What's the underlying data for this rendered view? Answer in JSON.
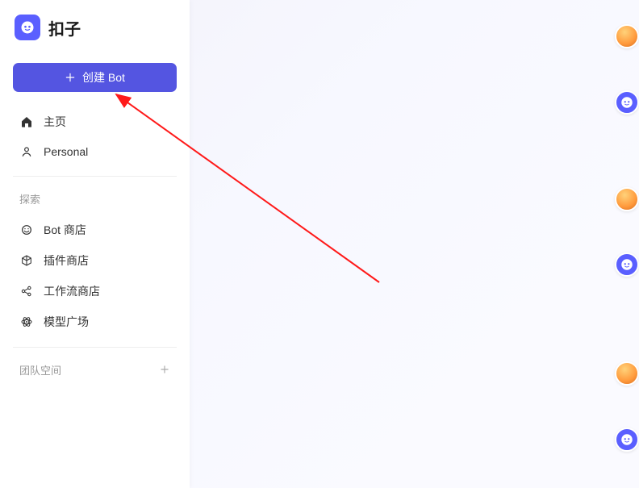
{
  "app": {
    "name": "扣子"
  },
  "sidebar": {
    "createBtn": "创建 Bot",
    "nav": {
      "home": "主页",
      "personal": "Personal"
    },
    "exploreTitle": "探索",
    "explore": {
      "botStore": "Bot 商店",
      "pluginStore": "插件商店",
      "workflowStore": "工作流商店",
      "modelPlayground": "模型广场"
    },
    "teamTitle": "团队空间"
  }
}
